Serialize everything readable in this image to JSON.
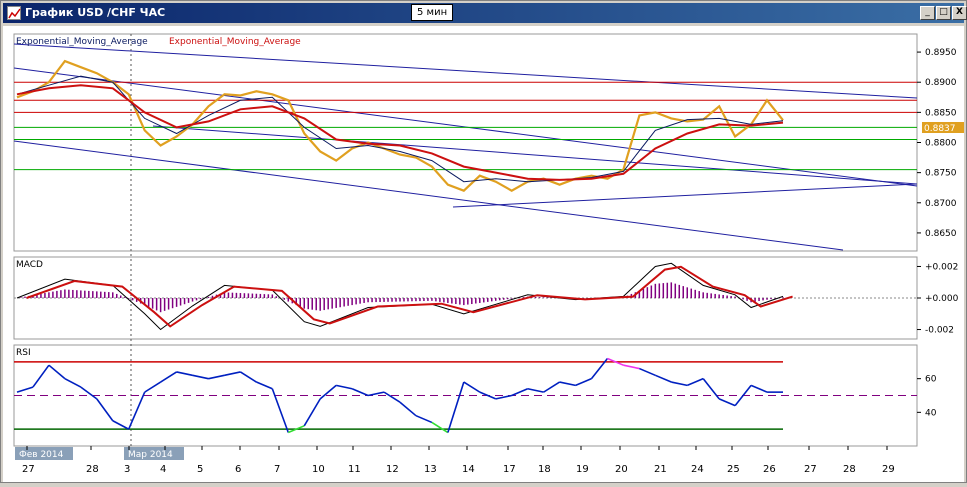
{
  "window": {
    "title": "График USD /CHF  ЧАС",
    "timeframe_badge": "5 мин",
    "btn_min": "_",
    "btn_max": "□",
    "btn_close": "X"
  },
  "colors": {
    "price": "#e0a020",
    "ema_fast": "#0a1a60",
    "ema_slow": "#cc1010",
    "trend": "#2020a0",
    "level_red": "#cc0000",
    "level_green": "#00aa00",
    "macd_hist": "#800080",
    "rsi": "#0020c0",
    "rsi_low": "#33dd33",
    "rsi_high": "#ee33ee",
    "current_price_bg": "#e0a020"
  },
  "main_panel": {
    "legend_1": "Exponential_Moving_Average",
    "legend_2": "Exponential_Moving_Average",
    "current_price": "0.8837",
    "y_ticks": [
      "0.8950",
      "0.8900",
      "0.8850",
      "0.8800",
      "0.8750",
      "0.8700",
      "0.8650"
    ]
  },
  "macd_panel": {
    "label": "MACD",
    "y_ticks": [
      "+0.002",
      "+0.000",
      "-0.002"
    ]
  },
  "rsi_panel": {
    "label": "RSI",
    "y_ticks": [
      "60",
      "40"
    ]
  },
  "x_axis": {
    "ticks": [
      "27",
      "28",
      "3",
      "4",
      "5",
      "6",
      "7",
      "10",
      "11",
      "12",
      "13",
      "14",
      "17",
      "18",
      "19",
      "20",
      "21",
      "24",
      "25",
      "26",
      "27",
      "28",
      "29"
    ],
    "month_label_1": "Фев 2014",
    "month_label_2": "Мар 2014"
  },
  "chart_data": {
    "type": "line",
    "y_range": [
      0.862,
      0.898
    ],
    "price_path": [
      [
        0,
        0.8875
      ],
      [
        1,
        0.8885
      ],
      [
        2,
        0.89
      ],
      [
        3,
        0.8935
      ],
      [
        4,
        0.8925
      ],
      [
        5,
        0.8915
      ],
      [
        6,
        0.89
      ],
      [
        7,
        0.888
      ],
      [
        8,
        0.882
      ],
      [
        9,
        0.8795
      ],
      [
        10,
        0.881
      ],
      [
        11,
        0.883
      ],
      [
        12,
        0.886
      ],
      [
        13,
        0.888
      ],
      [
        14,
        0.8878
      ],
      [
        15,
        0.8885
      ],
      [
        16,
        0.888
      ],
      [
        17,
        0.887
      ],
      [
        18,
        0.8815
      ],
      [
        19,
        0.8785
      ],
      [
        20,
        0.877
      ],
      [
        21,
        0.879
      ],
      [
        22,
        0.88
      ],
      [
        23,
        0.879
      ],
      [
        24,
        0.878
      ],
      [
        25,
        0.8775
      ],
      [
        26,
        0.876
      ],
      [
        27,
        0.873
      ],
      [
        28,
        0.872
      ],
      [
        29,
        0.8745
      ],
      [
        30,
        0.8735
      ],
      [
        31,
        0.872
      ],
      [
        32,
        0.8735
      ],
      [
        33,
        0.874
      ],
      [
        34,
        0.873
      ],
      [
        35,
        0.874
      ],
      [
        36,
        0.8745
      ],
      [
        37,
        0.874
      ],
      [
        38,
        0.8755
      ],
      [
        39,
        0.8845
      ],
      [
        40,
        0.885
      ],
      [
        41,
        0.884
      ],
      [
        42,
        0.8835
      ],
      [
        43,
        0.8838
      ],
      [
        44,
        0.886
      ],
      [
        45,
        0.881
      ],
      [
        46,
        0.883
      ],
      [
        47,
        0.887
      ],
      [
        48,
        0.8837
      ]
    ],
    "ema_fast": [
      [
        0,
        0.888
      ],
      [
        2,
        0.8895
      ],
      [
        4,
        0.891
      ],
      [
        6,
        0.89
      ],
      [
        8,
        0.884
      ],
      [
        10,
        0.8815
      ],
      [
        12,
        0.8845
      ],
      [
        14,
        0.887
      ],
      [
        16,
        0.8875
      ],
      [
        18,
        0.8825
      ],
      [
        20,
        0.879
      ],
      [
        22,
        0.8795
      ],
      [
        24,
        0.8785
      ],
      [
        26,
        0.877
      ],
      [
        28,
        0.8735
      ],
      [
        30,
        0.874
      ],
      [
        32,
        0.8735
      ],
      [
        34,
        0.8738
      ],
      [
        36,
        0.8742
      ],
      [
        38,
        0.8752
      ],
      [
        40,
        0.882
      ],
      [
        42,
        0.8838
      ],
      [
        44,
        0.884
      ],
      [
        46,
        0.883
      ],
      [
        48,
        0.8836
      ]
    ],
    "ema_slow": [
      [
        0,
        0.888
      ],
      [
        2,
        0.889
      ],
      [
        4,
        0.8895
      ],
      [
        6,
        0.889
      ],
      [
        8,
        0.885
      ],
      [
        10,
        0.8825
      ],
      [
        12,
        0.8835
      ],
      [
        14,
        0.8855
      ],
      [
        16,
        0.886
      ],
      [
        18,
        0.884
      ],
      [
        20,
        0.8805
      ],
      [
        22,
        0.8798
      ],
      [
        24,
        0.8795
      ],
      [
        26,
        0.8782
      ],
      [
        28,
        0.876
      ],
      [
        30,
        0.875
      ],
      [
        32,
        0.874
      ],
      [
        34,
        0.8738
      ],
      [
        36,
        0.874
      ],
      [
        38,
        0.8748
      ],
      [
        40,
        0.879
      ],
      [
        42,
        0.8815
      ],
      [
        44,
        0.883
      ],
      [
        46,
        0.8828
      ],
      [
        48,
        0.8833
      ]
    ],
    "levels_red": [
      0.89,
      0.887,
      0.885
    ],
    "levels_green": [
      0.8825,
      0.8805,
      0.8755
    ],
    "macd": [
      [
        0,
        0.0
      ],
      [
        3,
        0.0012
      ],
      [
        6,
        0.0008
      ],
      [
        8,
        -0.001
      ],
      [
        9,
        -0.002
      ],
      [
        11,
        -0.0005
      ],
      [
        13,
        0.0008
      ],
      [
        16,
        0.0005
      ],
      [
        18,
        -0.0015
      ],
      [
        19,
        -0.0018
      ],
      [
        22,
        -0.0006
      ],
      [
        26,
        -0.0004
      ],
      [
        28,
        -0.001
      ],
      [
        32,
        0.0002
      ],
      [
        35,
        -0.0001
      ],
      [
        38,
        0.0001
      ],
      [
        40,
        0.002
      ],
      [
        41,
        0.0022
      ],
      [
        43,
        0.0008
      ],
      [
        45,
        0.0002
      ],
      [
        46,
        -0.0006
      ],
      [
        48,
        0.0001
      ]
    ],
    "rsi": [
      [
        0,
        52
      ],
      [
        1,
        55
      ],
      [
        2,
        68
      ],
      [
        3,
        60
      ],
      [
        4,
        55
      ],
      [
        5,
        48
      ],
      [
        6,
        35
      ],
      [
        7,
        30
      ],
      [
        8,
        52
      ],
      [
        9,
        58
      ],
      [
        10,
        64
      ],
      [
        11,
        62
      ],
      [
        12,
        60
      ],
      [
        13,
        62
      ],
      [
        14,
        64
      ],
      [
        15,
        58
      ],
      [
        16,
        54
      ],
      [
        17,
        28
      ],
      [
        18,
        32
      ],
      [
        19,
        48
      ],
      [
        20,
        56
      ],
      [
        21,
        54
      ],
      [
        22,
        50
      ],
      [
        23,
        52
      ],
      [
        24,
        46
      ],
      [
        25,
        38
      ],
      [
        26,
        34
      ],
      [
        27,
        28
      ],
      [
        28,
        58
      ],
      [
        29,
        52
      ],
      [
        30,
        48
      ],
      [
        31,
        50
      ],
      [
        32,
        54
      ],
      [
        33,
        52
      ],
      [
        34,
        58
      ],
      [
        35,
        56
      ],
      [
        36,
        60
      ],
      [
        37,
        72
      ],
      [
        38,
        68
      ],
      [
        39,
        66
      ],
      [
        40,
        62
      ],
      [
        41,
        58
      ],
      [
        42,
        56
      ],
      [
        43,
        60
      ],
      [
        44,
        48
      ],
      [
        45,
        44
      ],
      [
        46,
        56
      ],
      [
        47,
        52
      ],
      [
        48,
        52
      ]
    ],
    "rsi_levels": [
      70,
      50,
      30
    ],
    "rsi_range": [
      20,
      80
    ]
  }
}
